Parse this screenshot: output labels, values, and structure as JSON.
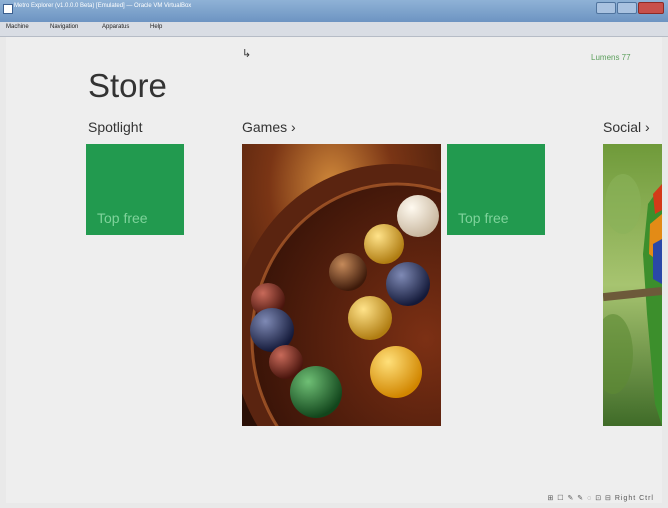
{
  "window": {
    "title": "Metro Explorer (v1.0.0.0 Beta) [Emulated] — Oracle VM VirtualBox",
    "menu": [
      "Machine",
      "Navigation",
      "Apparatus",
      "Help"
    ]
  },
  "store": {
    "title": "Store",
    "signin": "Lumens 77",
    "sections": [
      {
        "heading": "Spotlight",
        "tiles": [
          {
            "label": "Top free"
          }
        ]
      },
      {
        "heading": "Games ›",
        "tiles": [
          {
            "image": "marbles-photo"
          },
          {
            "label": "Top free"
          }
        ]
      },
      {
        "heading": "Social ›",
        "tiles": [
          {
            "image": "parrot-photo"
          }
        ]
      }
    ]
  },
  "taskbar": {
    "status_text": "⊞ ☐ ✎ ✎ ◌ ⊡ ⊟ Right Ctrl"
  },
  "colors": {
    "tile_green": "#229a4f",
    "tile_label": "#7fd39b"
  }
}
